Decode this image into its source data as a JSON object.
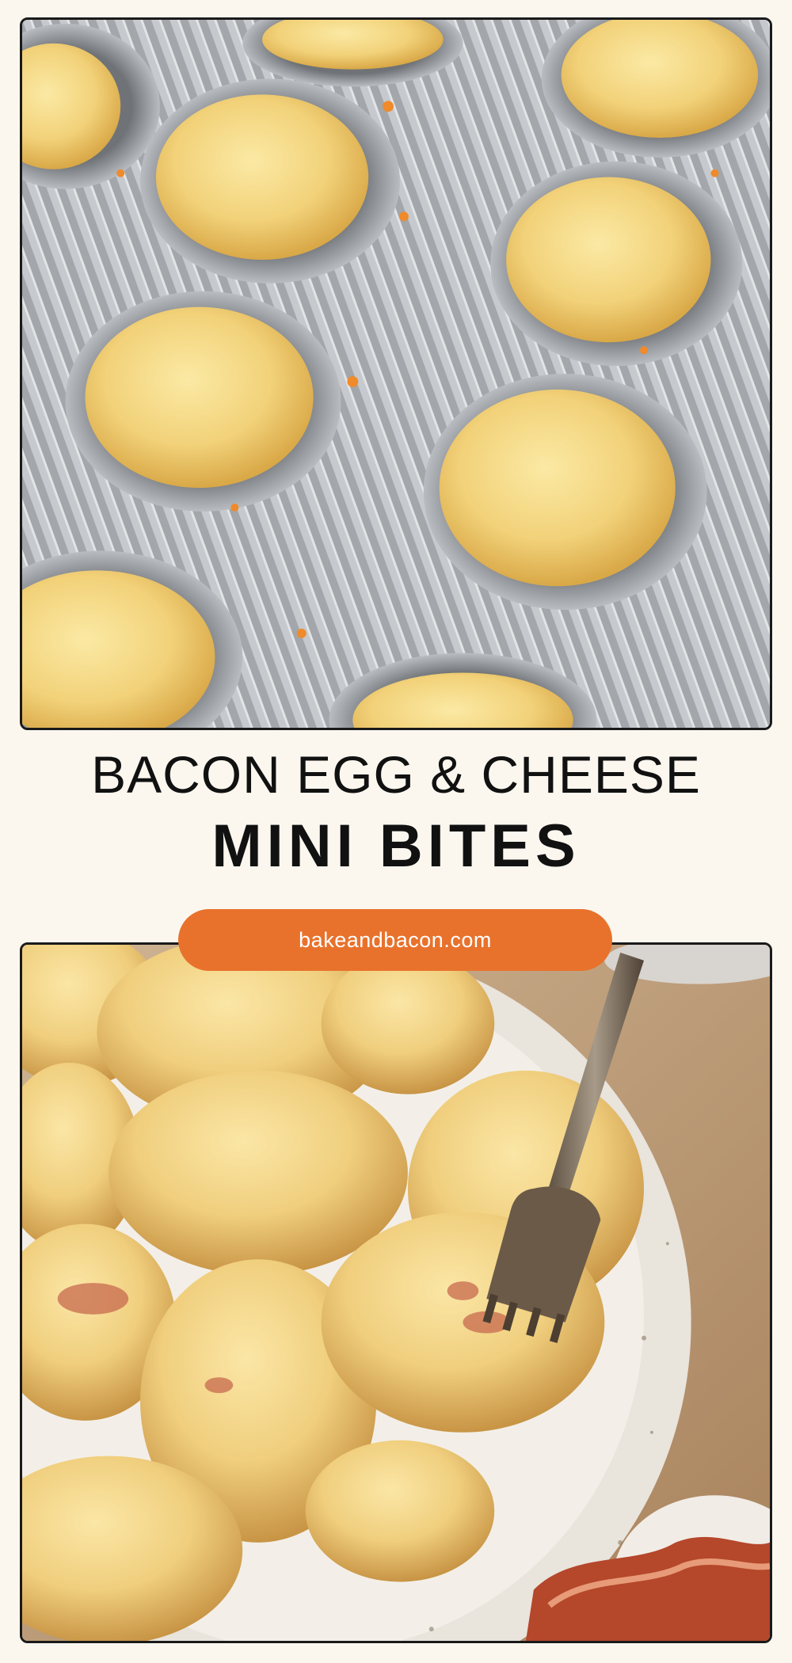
{
  "header": {
    "title_line1": "BACON EGG & CHEESE",
    "title_line2": "MINI BITES"
  },
  "badge": {
    "url": "bakeandbacon.com"
  },
  "colors": {
    "background": "#fbf7ef",
    "accent": "#e8722c",
    "text": "#111111",
    "frame": "#1a1a1a"
  },
  "images": {
    "top": "egg-bites-in-muffin-tin-photo",
    "bottom": "egg-bites-on-plate-with-fork-photo"
  }
}
